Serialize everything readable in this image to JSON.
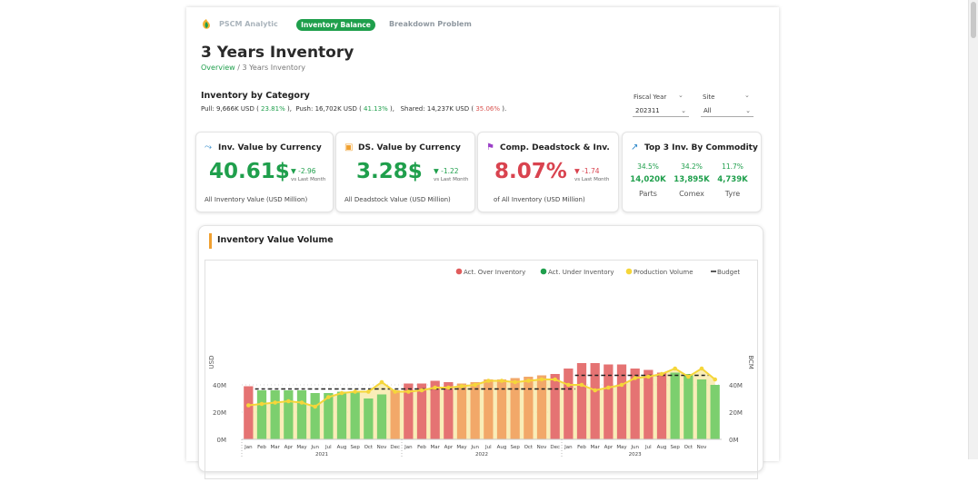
{
  "nav": {
    "brand": "PSCM Analytic",
    "active_tab": "Inventory Balance",
    "tab2": "Breakdown Problem"
  },
  "page": {
    "title": "3 Years Inventory",
    "breadcrumb_link": "Overview",
    "breadcrumb_sep": "/",
    "breadcrumb_current": "3 Years Inventory"
  },
  "category": {
    "title": "Inventory by Category",
    "pull_label": "Pull:",
    "pull_value": "9,666K USD",
    "pull_pct": "23.81%",
    "push_label": "Push:",
    "push_value": "16,702K USD",
    "push_pct": "41.13%",
    "shared_label": "Shared:",
    "shared_value": "14,237K USD",
    "shared_pct": "35.06%"
  },
  "filters": {
    "fiscal_year_label": "Fiscal Year",
    "fiscal_year_value": "202311",
    "site_label": "Site",
    "site_value": "All"
  },
  "kpis": {
    "inv_value": {
      "title": "Inv. Value by Currency",
      "value": "40.61$",
      "delta": "-2.96",
      "vs": "vs Last Month",
      "footer": "All Inventory Value (USD Million)",
      "color": "#1f9f4c"
    },
    "ds_value": {
      "title": "DS. Value by Currency",
      "value": "3.28$",
      "delta": "-1.22",
      "vs": "vs Last Month",
      "footer": "All Deadstock Value (USD Million)",
      "color": "#1f9f4c"
    },
    "deadstock": {
      "title": "Comp. Deadstock & Inv.",
      "value": "8.07%",
      "delta": "-1.74",
      "vs": "vs Last Month",
      "footer": "of All Inventory (USD Million)",
      "color": "#d9434f"
    },
    "top3": {
      "title": "Top 3 Inv. By Commodity",
      "items": [
        {
          "pct": "34.5%",
          "value": "14,020K",
          "name": "Parts"
        },
        {
          "pct": "34.2%",
          "value": "13,895K",
          "name": "Comex"
        },
        {
          "pct": "11.7%",
          "value": "4,739K",
          "name": "Tyre"
        }
      ]
    }
  },
  "chart_data": {
    "type": "bar",
    "title": "Inventory Value Volume",
    "ylabel": "USD",
    "y2label": "BCM",
    "ylim": [
      0,
      40
    ],
    "y_ticks": [
      "0M",
      "20M",
      "40M"
    ],
    "y2_ticks": [
      "0M",
      "20M",
      "40M"
    ],
    "legend": [
      {
        "name": "Act. Over Inventory",
        "color": "#e05c5c"
      },
      {
        "name": "Act. Under Inventory",
        "color": "#1f9f4c"
      },
      {
        "name": "Production Volume",
        "color": "#f5d63a"
      },
      {
        "name": "Budget",
        "color": "#222222"
      }
    ],
    "categories": [
      "Jan",
      "Feb",
      "Mar",
      "Apr",
      "May",
      "Jun",
      "Jul",
      "Aug",
      "Sep",
      "Oct",
      "Nov",
      "Dec",
      "Jan",
      "Feb",
      "Mar",
      "Apr",
      "May",
      "Jun",
      "Jul",
      "Aug",
      "Sep",
      "Oct",
      "Nov",
      "Dec",
      "Jan",
      "Feb",
      "Mar",
      "Apr",
      "May",
      "Jun",
      "Jul",
      "Aug",
      "Sep",
      "Oct",
      "Nov"
    ],
    "years": [
      {
        "label": "2021",
        "start": 0,
        "end": 11
      },
      {
        "label": "2022",
        "start": 12,
        "end": 23
      },
      {
        "label": "2023",
        "start": 24,
        "end": 34
      }
    ],
    "series": [
      {
        "name": "Inventory",
        "values": [
          39,
          36,
          36,
          36,
          36,
          34,
          34,
          35,
          35,
          30,
          33,
          36,
          41,
          41,
          43,
          42,
          41,
          42,
          44,
          44,
          45,
          46,
          47,
          48,
          52,
          56,
          56,
          55,
          55,
          52,
          51,
          49,
          49,
          48,
          44,
          40
        ]
      },
      {
        "name": "Inventory Status",
        "status": [
          "over",
          "under",
          "under",
          "under",
          "under",
          "under",
          "under",
          "under",
          "under",
          "under",
          "under",
          "neutral",
          "over",
          "over",
          "over",
          "over",
          "neutral",
          "neutral",
          "neutral",
          "neutral",
          "neutral",
          "neutral",
          "neutral",
          "over",
          "over",
          "over",
          "over",
          "over",
          "over",
          "over",
          "over",
          "over",
          "under",
          "under",
          "under",
          "under"
        ]
      },
      {
        "name": "Budget",
        "values": [
          null,
          37,
          37,
          37,
          37,
          37,
          37,
          37,
          37,
          37,
          37,
          37,
          37,
          37,
          37,
          37,
          37,
          37,
          37,
          37,
          37,
          37,
          37,
          37,
          37,
          47,
          47,
          47,
          47,
          47,
          47,
          47,
          47,
          47,
          47,
          null
        ]
      },
      {
        "name": "Production Volume",
        "values": [
          25,
          26,
          27,
          28,
          27,
          24,
          31,
          34,
          35,
          35,
          42,
          35,
          35,
          36,
          38,
          38,
          39,
          40,
          43,
          43,
          42,
          43,
          44,
          44,
          40,
          40,
          36,
          38,
          40,
          45,
          46,
          48,
          52,
          46,
          52,
          44
        ]
      }
    ]
  }
}
